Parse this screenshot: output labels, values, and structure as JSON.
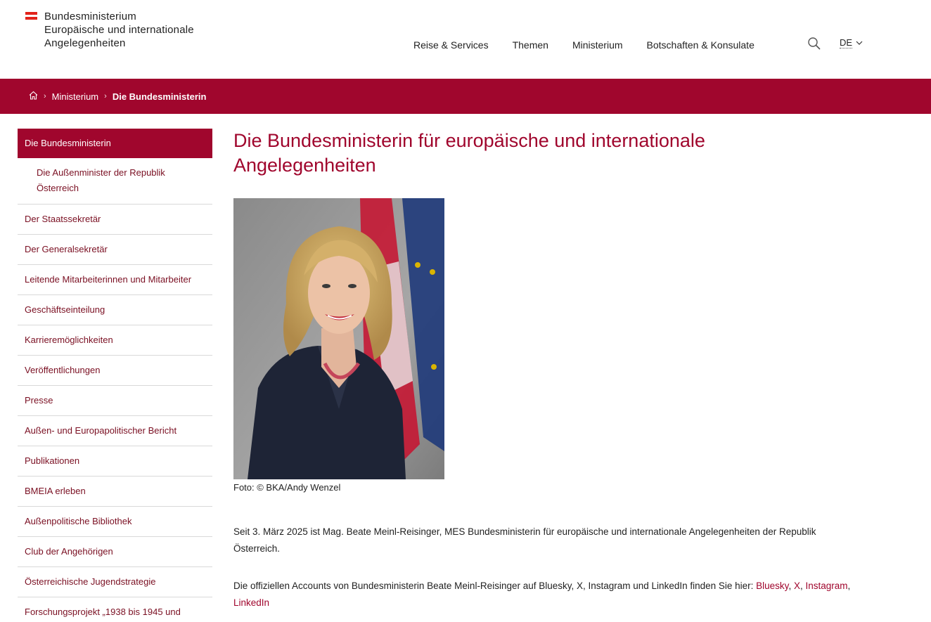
{
  "header": {
    "logo_lines": [
      "Bundesministerium",
      "Europäische und internationale",
      "Angelegenheiten"
    ],
    "nav": [
      "Reise & Services",
      "Themen",
      "Ministerium",
      "Botschaften & Konsulate"
    ],
    "language": "DE"
  },
  "breadcrumb": {
    "home_icon": "home-icon",
    "items": [
      "Ministerium",
      "Die Bundesministerin"
    ]
  },
  "sidebar": {
    "items": [
      "Die Bundesministerin",
      "Die Außenminister der Republik Österreich",
      "Der Staatssekretär",
      "Der Generalsekretär",
      "Leitende Mitarbeiterinnen und Mitarbeiter",
      "Geschäftseinteilung",
      "Karrieremöglichkeiten",
      "Veröffentlichungen",
      "Presse",
      "Außen- und Europapolitischer Bericht",
      "Publikationen",
      "BMEIA erleben",
      "Außenpolitische Bibliothek",
      "Club der Angehörigen",
      "Österreichische Jugendstrategie",
      "Forschungsprojekt „1938 bis 1945 und"
    ]
  },
  "main": {
    "title": "Die Bundesministerin für europäische und internationale Angelegenheiten",
    "photo_caption": "Foto: © BKA/Andy Wenzel",
    "intro": "Seit 3. März 2025 ist Mag. Beate Meinl-Reisinger, MES Bundesministerin für europäische und internationale Angelegenheiten der Republik Österreich.",
    "accounts_text": "Die offiziellen Accounts von Bundesministerin Beate Meinl-Reisinger auf Bluesky, X, Instagram und LinkedIn finden Sie hier: ",
    "links": [
      "Bluesky",
      "X",
      "Instagram",
      "LinkedIn"
    ],
    "link_separator": ", "
  },
  "colors": {
    "brand": "#a0062d",
    "flag_red": "#e2231a",
    "text": "#222222"
  }
}
